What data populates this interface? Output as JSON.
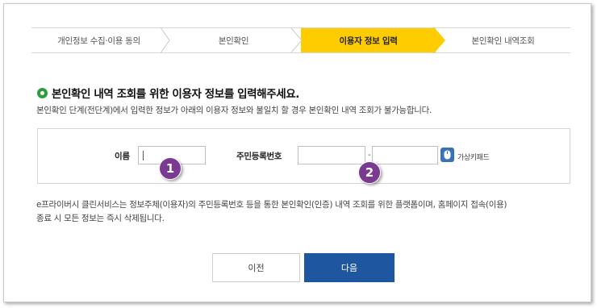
{
  "stepper": {
    "steps": [
      {
        "label": "개인정보 수집·이용 동의",
        "active": false
      },
      {
        "label": "본인확인",
        "active": false
      },
      {
        "label": "이용자 정보 입력",
        "active": true
      },
      {
        "label": "본인확인 내역조회",
        "active": false
      }
    ],
    "active_color": "#ffcc00"
  },
  "heading": {
    "title": "본인확인 내역 조회를 위한 이용자 정보를 입력해주세요.",
    "subtitle": "본인확인 단계(전단계)에서 입력한 정보가 아래의 이용자 정보와 불일치 할 경우 본인확인 내역 조회가 불가능합니다."
  },
  "form": {
    "name_label": "이름",
    "name_value": "",
    "rrn_label": "주민등록번호",
    "rrn_first_value": "",
    "rrn_separator": "-",
    "rrn_second_value": "",
    "virtual_keypad_label": "가상키패드"
  },
  "badges": [
    "1",
    "2"
  ],
  "notice": {
    "line1": "e프라이버시 클린서비스는 정보주체(이용자)의 주민등록번호 등을 통한 본인확인(인증) 내역 조회를 위한 플랫폼이며, 홈페이지 접속(이용)",
    "line2": "종료 시 모든 정보는 즉시 삭제됩니다."
  },
  "buttons": {
    "prev": "이전",
    "next": "다음"
  },
  "colors": {
    "primary_button": "#1e56a0",
    "badge": "#7b3a92",
    "bullet": "#2f9d3c"
  }
}
